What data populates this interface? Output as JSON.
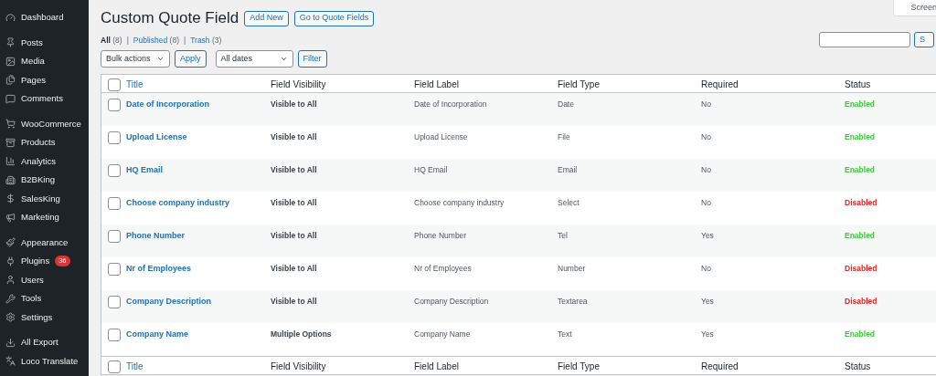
{
  "sidebar": {
    "groups": [
      [
        {
          "label": "Dashboard"
        }
      ],
      [
        {
          "label": "Posts"
        },
        {
          "label": "Media"
        },
        {
          "label": "Pages"
        },
        {
          "label": "Comments"
        }
      ],
      [
        {
          "label": "WooCommerce"
        },
        {
          "label": "Products"
        },
        {
          "label": "Analytics"
        },
        {
          "label": "B2BKing"
        },
        {
          "label": "SalesKing"
        },
        {
          "label": "Marketing"
        }
      ],
      [
        {
          "label": "Appearance"
        },
        {
          "label": "Plugins",
          "badge": "36"
        },
        {
          "label": "Users"
        },
        {
          "label": "Tools"
        },
        {
          "label": "Settings"
        }
      ],
      [
        {
          "label": "All Export"
        },
        {
          "label": "Loco Translate"
        }
      ]
    ]
  },
  "header": {
    "title": "Custom Quote Field",
    "buttons": [
      "Add New",
      "Go to Quote Fields"
    ],
    "screen_options": "Screen"
  },
  "views": [
    {
      "label": "All",
      "count": "(8)",
      "selected": true
    },
    {
      "label": "Published",
      "count": "(8)",
      "selected": false
    },
    {
      "label": "Trash",
      "count": "(3)",
      "selected": false
    }
  ],
  "views_separator": "|",
  "search": {
    "button": "S"
  },
  "bulk_actions": {
    "value": "Bulk actions",
    "button": "Apply"
  },
  "date_filter": {
    "value": "All dates",
    "button": "Filter"
  },
  "table": {
    "select_all_checked": false,
    "footer_select_all_checked": false,
    "columns": [
      "Title",
      "Field Visibility",
      "Field Label",
      "Field Type",
      "Required",
      "Status"
    ],
    "rows": [
      {
        "title": "Date of Incorporation",
        "visibility": "Visible to All",
        "label": "Date of Incorporation",
        "type": "Date",
        "required": "No",
        "status": "Enabled",
        "enabled": true,
        "checked": false
      },
      {
        "title": "Upload License",
        "visibility": "Visible to All",
        "label": "Upload License",
        "type": "File",
        "required": "No",
        "status": "Enabled",
        "enabled": true,
        "checked": false
      },
      {
        "title": "HQ Email",
        "visibility": "Visible to All",
        "label": "HQ Email",
        "type": "Email",
        "required": "No",
        "status": "Enabled",
        "enabled": true,
        "checked": false
      },
      {
        "title": "Choose company industry",
        "visibility": "Visible to All",
        "label": "Choose company industry",
        "type": "Select",
        "required": "No",
        "status": "Disabled",
        "enabled": false,
        "checked": false
      },
      {
        "title": "Phone Number",
        "visibility": "Visible to All",
        "label": "Phone Number",
        "type": "Tel",
        "required": "Yes",
        "status": "Enabled",
        "enabled": true,
        "checked": false
      },
      {
        "title": "Nr of Employees",
        "visibility": "Visible to All",
        "label": "Nr of Employees",
        "type": "Number",
        "required": "No",
        "status": "Disabled",
        "enabled": false,
        "checked": false
      },
      {
        "title": "Company Description",
        "visibility": "Visible to All",
        "label": "Company Description",
        "type": "Textarea",
        "required": "Yes",
        "status": "Disabled",
        "enabled": false,
        "checked": false
      },
      {
        "title": "Company Name",
        "visibility": "Multiple Options",
        "label": "Company Name",
        "type": "Text",
        "required": "Yes",
        "status": "Enabled",
        "enabled": true,
        "checked": false
      }
    ],
    "footer_columns": [
      "Title",
      "Field Visibility",
      "Field Label",
      "Field Type",
      "Required",
      "Status"
    ]
  }
}
